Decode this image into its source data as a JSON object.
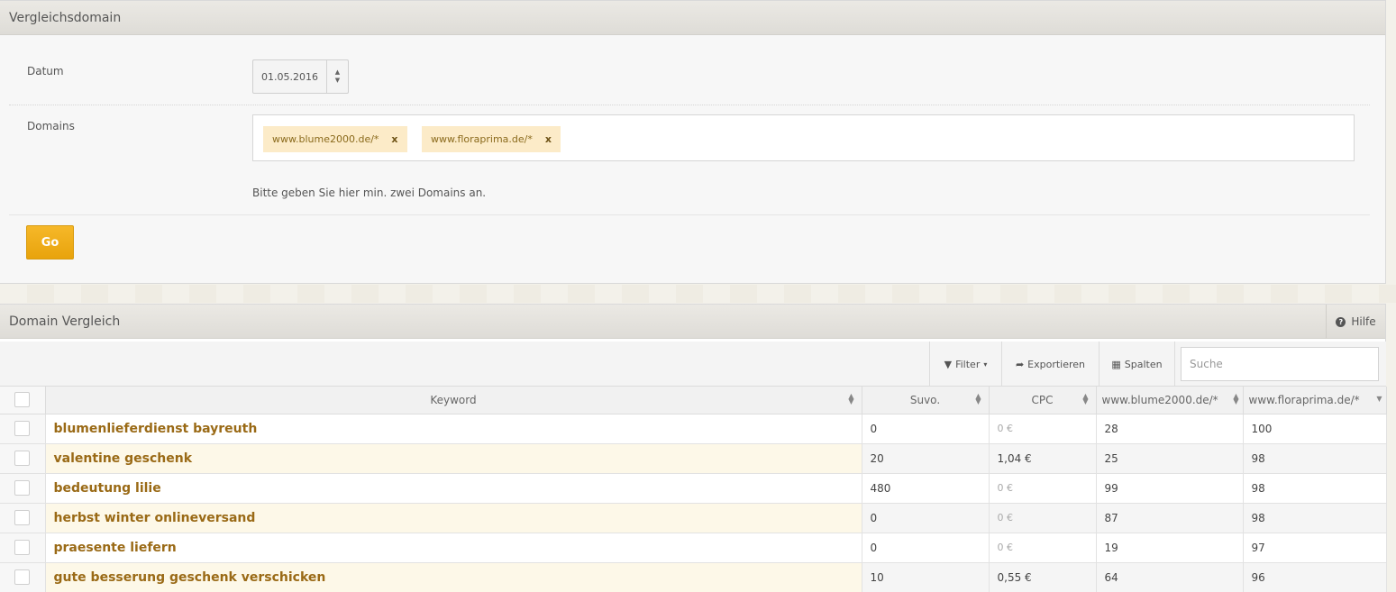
{
  "top_panel": {
    "title": "Vergleichsdomain",
    "date_label": "Datum",
    "date_value": "01.05.2016",
    "domains_label": "Domains",
    "domains": [
      {
        "text": "www.blume2000.de/*",
        "remove": "x"
      },
      {
        "text": "www.floraprima.de/*",
        "remove": "x"
      }
    ],
    "hint": "Bitte geben Sie hier min. zwei Domains an.",
    "go_label": "Go"
  },
  "bottom_panel": {
    "title": "Domain Vergleich",
    "help_label": "Hilfe",
    "toolbar": {
      "filter_label": "Filter",
      "export_label": "Exportieren",
      "columns_label": "Spalten",
      "search_placeholder": "Suche"
    },
    "columns": [
      "Keyword",
      "Suvo.",
      "CPC",
      "www.blume2000.de/*",
      "www.floraprima.de/*"
    ],
    "rows": [
      {
        "keyword": "blumenlieferdienst bayreuth",
        "suvo": "0",
        "cpc": "0 €",
        "d1": "28",
        "d2": "100"
      },
      {
        "keyword": "valentine geschenk",
        "suvo": "20",
        "cpc": "1,04 €",
        "d1": "25",
        "d2": "98"
      },
      {
        "keyword": "bedeutung lilie",
        "suvo": "480",
        "cpc": "0 €",
        "d1": "99",
        "d2": "98"
      },
      {
        "keyword": "herbst winter onlineversand",
        "suvo": "0",
        "cpc": "0 €",
        "d1": "87",
        "d2": "98"
      },
      {
        "keyword": "praesente liefern",
        "suvo": "0",
        "cpc": "0 €",
        "d1": "19",
        "d2": "97"
      },
      {
        "keyword": "gute besserung geschenk verschicken",
        "suvo": "10",
        "cpc": "0,55 €",
        "d1": "64",
        "d2": "96"
      }
    ]
  },
  "colors": {
    "accent": "#f0ad1a",
    "keyword": "#9a6a16",
    "tag_bg": "#fcebc8"
  }
}
